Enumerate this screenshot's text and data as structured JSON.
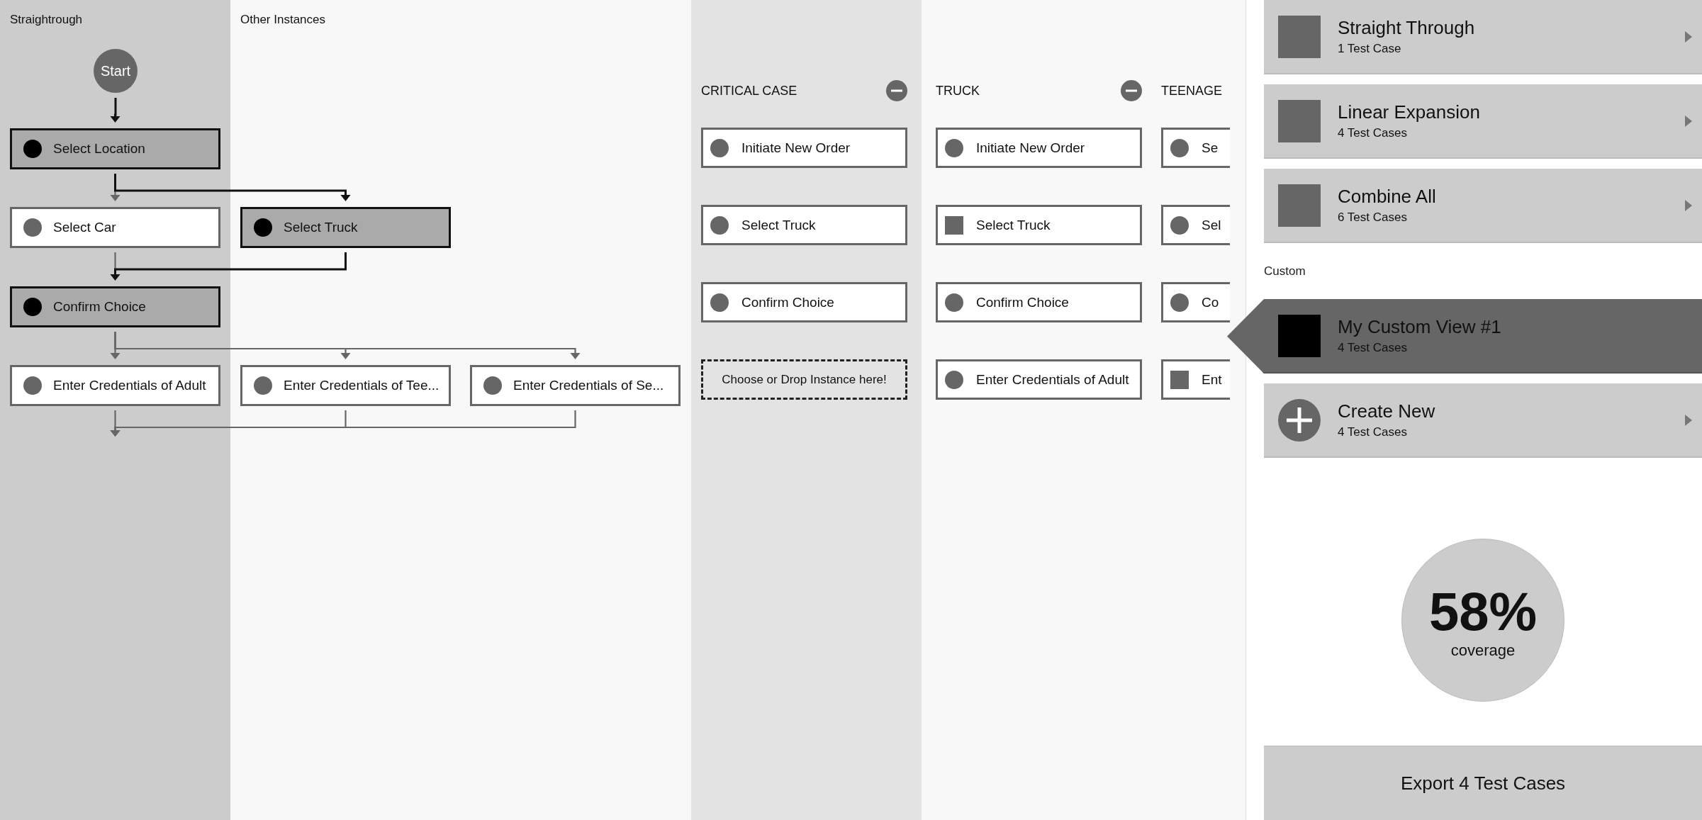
{
  "flow": {
    "lanes": [
      {
        "title": "Straightrough"
      },
      {
        "title": "Other Instances"
      }
    ],
    "start": {
      "label": "Start"
    },
    "rows": [
      [
        {
          "label": "Select Location",
          "selected": true
        }
      ],
      [
        {
          "label": "Select Car",
          "selected": false
        },
        {
          "label": "Select Truck",
          "selected": true
        }
      ],
      [
        {
          "label": "Confirm Choice",
          "selected": true
        }
      ],
      [
        {
          "label": "Enter Credentials of Adult",
          "selected": false
        },
        {
          "label": "Enter Credentials of Tee...",
          "selected": false
        },
        {
          "label": "Enter Credentials of Se...",
          "selected": false
        }
      ]
    ]
  },
  "instances": [
    {
      "title": "CRITICAL CASE",
      "selected": true,
      "removable": true,
      "steps": [
        {
          "kind": "circle",
          "label": "Initiate New Order"
        },
        {
          "kind": "circle",
          "label": "Select Truck"
        },
        {
          "kind": "circle",
          "label": "Confirm Choice"
        },
        {
          "kind": "dropzone",
          "label": "Choose or Drop Instance here!"
        }
      ]
    },
    {
      "title": "TRUCK",
      "selected": false,
      "removable": true,
      "steps": [
        {
          "kind": "circle",
          "label": "Initiate New Order"
        },
        {
          "kind": "square",
          "label": "Select Truck"
        },
        {
          "kind": "circle",
          "label": "Confirm Choice"
        },
        {
          "kind": "circle",
          "label": "Enter Credentials of Adult"
        }
      ]
    },
    {
      "title": "TEENAGE",
      "selected": false,
      "removable": false,
      "steps": [
        {
          "kind": "circle",
          "label": "Se"
        },
        {
          "kind": "circle",
          "label": "Sel"
        },
        {
          "kind": "circle",
          "label": "Co"
        },
        {
          "kind": "square",
          "label": "Ent"
        }
      ]
    }
  ],
  "panel": {
    "views": [
      {
        "title": "Straight Through",
        "subtitle": "1 Test Case",
        "kind": "view",
        "selected": false
      },
      {
        "title": "Linear Expansion",
        "subtitle": "4 Test Cases",
        "kind": "view",
        "selected": false
      },
      {
        "title": "Combine All",
        "subtitle": "6 Test Cases",
        "kind": "view",
        "selected": false
      }
    ],
    "custom_heading": "Custom",
    "custom_views": [
      {
        "title": "My Custom View #1",
        "subtitle": "4 Test Cases",
        "kind": "view",
        "selected": true
      },
      {
        "title": "Create New",
        "subtitle": "4 Test Cases",
        "kind": "create",
        "selected": false
      }
    ],
    "coverage": {
      "value": "58%",
      "label": "coverage"
    },
    "export_button": "Export 4 Test Cases"
  }
}
